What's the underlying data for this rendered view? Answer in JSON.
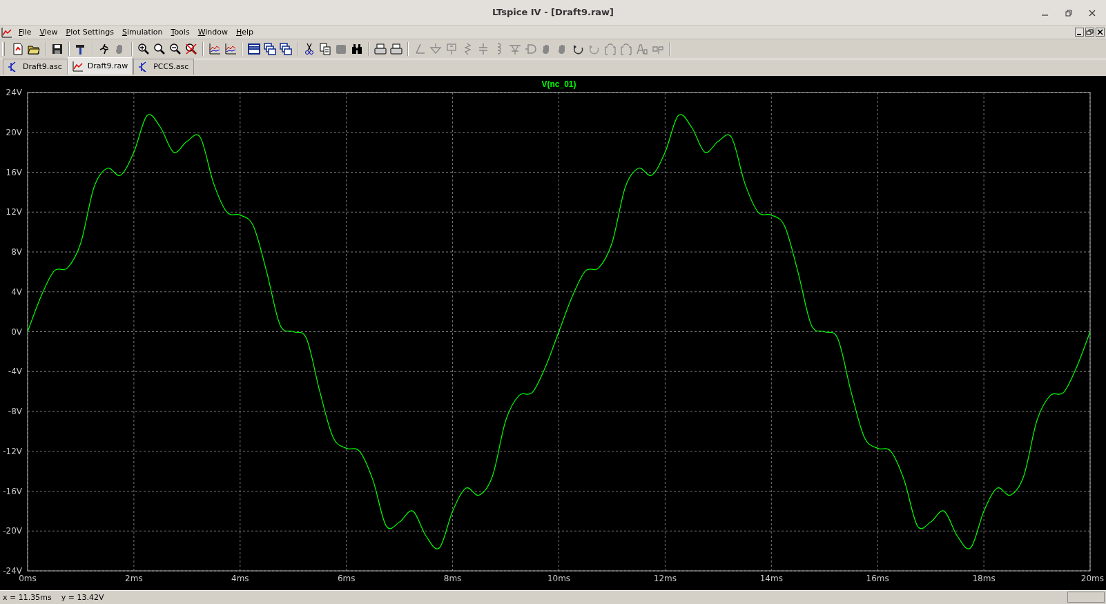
{
  "window": {
    "title": "LTspice IV - [Draft9.raw]"
  },
  "menu": [
    {
      "label": "File"
    },
    {
      "label": "View"
    },
    {
      "label": "Plot Settings"
    },
    {
      "label": "Simulation"
    },
    {
      "label": "Tools"
    },
    {
      "label": "Window"
    },
    {
      "label": "Help"
    }
  ],
  "tabs": [
    {
      "label": "Draft9.asc",
      "kind": "schematic",
      "selected": false
    },
    {
      "label": "Draft9.raw",
      "kind": "waveform",
      "selected": true
    },
    {
      "label": "PCCS.asc",
      "kind": "schematic",
      "selected": false
    }
  ],
  "plot": {
    "chart_data": {
      "type": "line",
      "grid": true,
      "xlim": [
        0,
        20
      ],
      "ylim": [
        -24,
        24
      ],
      "xticks": [
        {
          "value": 0,
          "label": "0ms"
        },
        {
          "value": 2,
          "label": "2ms"
        },
        {
          "value": 4,
          "label": "4ms"
        },
        {
          "value": 6,
          "label": "6ms"
        },
        {
          "value": 8,
          "label": "8ms"
        },
        {
          "value": 10,
          "label": "10ms"
        },
        {
          "value": 12,
          "label": "12ms"
        },
        {
          "value": 14,
          "label": "14ms"
        },
        {
          "value": 16,
          "label": "16ms"
        },
        {
          "value": 18,
          "label": "18ms"
        },
        {
          "value": 20,
          "label": "20ms"
        }
      ],
      "yticks": [
        {
          "value": 24,
          "label": "24V"
        },
        {
          "value": 20,
          "label": "20V"
        },
        {
          "value": 16,
          "label": "16V"
        },
        {
          "value": 12,
          "label": "12V"
        },
        {
          "value": 8,
          "label": "8V"
        },
        {
          "value": 4,
          "label": "4V"
        },
        {
          "value": 0,
          "label": "0V"
        },
        {
          "value": -4,
          "label": "-4V"
        },
        {
          "value": -8,
          "label": "-8V"
        },
        {
          "value": -12,
          "label": "-12V"
        },
        {
          "value": -16,
          "label": "-16V"
        },
        {
          "value": -20,
          "label": "-20V"
        },
        {
          "value": -24,
          "label": "-24V"
        }
      ],
      "x": [
        0,
        0.25,
        0.5,
        0.75,
        1,
        1.25,
        1.5,
        1.75,
        2,
        2.25,
        2.5,
        2.75,
        3,
        3.25,
        3.5,
        3.75,
        4,
        4.25,
        4.5,
        4.75,
        5,
        5.25,
        5.5,
        5.75,
        6,
        6.25,
        6.5,
        6.75,
        7,
        7.25,
        7.5,
        7.75,
        8,
        8.25,
        8.5,
        8.75,
        9,
        9.25,
        9.5,
        9.75,
        10,
        10.25,
        10.5,
        10.75,
        11,
        11.25,
        11.5,
        11.75,
        12,
        12.25,
        12.5,
        12.75,
        13,
        13.25,
        13.5,
        13.75,
        14,
        14.25,
        14.5,
        14.75,
        15,
        15.25,
        15.5,
        15.75,
        16,
        16.25,
        16.5,
        16.75,
        17,
        17.25,
        17.5,
        17.75,
        18,
        18.25,
        18.5,
        18.75,
        19,
        19.25,
        19.5,
        19.75,
        20
      ],
      "series": [
        {
          "name": "V(nc_01)",
          "color": "#00ff00",
          "values": [
            0,
            3.5,
            6.1,
            6.4,
            8.9,
            14.5,
            16.4,
            15.7,
            18,
            21.7,
            20.5,
            18,
            19.1,
            19.5,
            14.9,
            12,
            11.7,
            10.6,
            6,
            0.7,
            0,
            -0.7,
            -6,
            -10.6,
            -11.7,
            -12,
            -14.9,
            -19.5,
            -19.1,
            -18,
            -20.5,
            -21.7,
            -18,
            -15.7,
            -16.4,
            -14.5,
            -8.9,
            -6.4,
            -6.1,
            -3.5,
            0,
            3.5,
            6.1,
            6.4,
            8.9,
            14.5,
            16.4,
            15.7,
            18,
            21.7,
            20.5,
            18,
            19.1,
            19.5,
            14.9,
            12,
            11.7,
            10.6,
            6,
            0.7,
            0,
            -0.7,
            -6,
            -10.6,
            -11.7,
            -12,
            -14.9,
            -19.5,
            -19.1,
            -18,
            -20.5,
            -21.7,
            -18,
            -15.7,
            -16.4,
            -14.5,
            -8.9,
            -6.4,
            -6.1,
            -3.5,
            0
          ]
        }
      ]
    }
  },
  "status_bar": {
    "x_reading": "x = 11.35ms",
    "y_reading": "y = 13.42V"
  }
}
